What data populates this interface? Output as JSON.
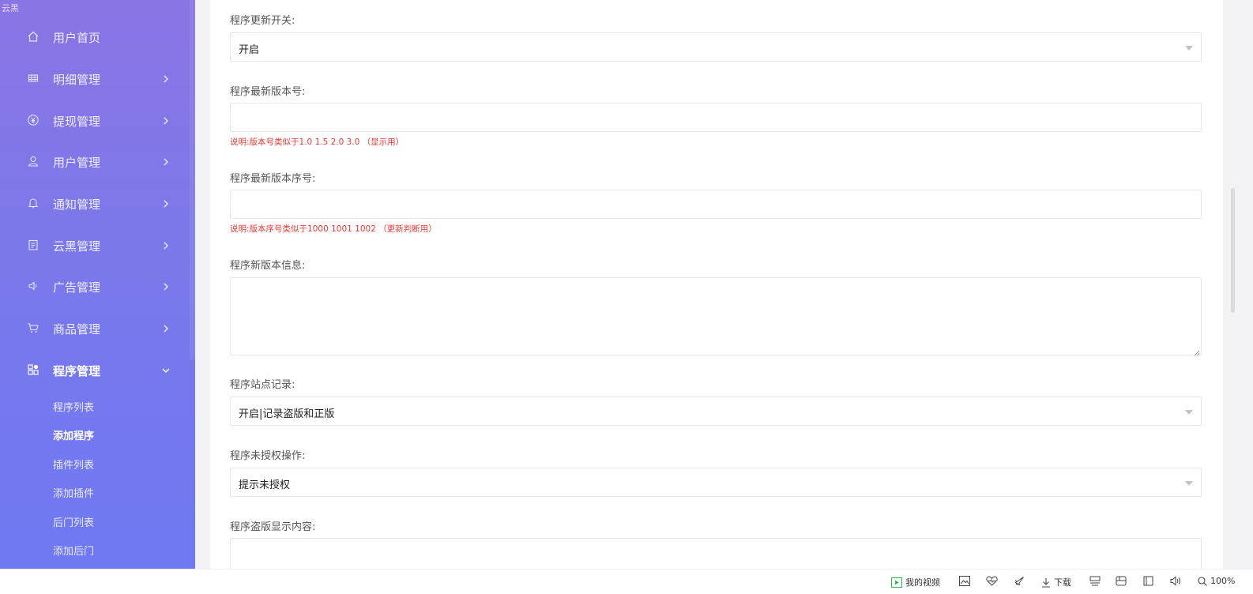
{
  "sidebar": {
    "corner_text": "云黑",
    "items": [
      {
        "label": "用户首页",
        "icon": "home-icon"
      },
      {
        "label": "明细管理",
        "icon": "list-icon"
      },
      {
        "label": "提现管理",
        "icon": "yen-icon"
      },
      {
        "label": "用户管理",
        "icon": "user-icon"
      },
      {
        "label": "通知管理",
        "icon": "bell-icon"
      },
      {
        "label": "云黑管理",
        "icon": "clipboard-icon"
      },
      {
        "label": "广告管理",
        "icon": "speaker-icon"
      },
      {
        "label": "商品管理",
        "icon": "cart-icon"
      },
      {
        "label": "程序管理",
        "icon": "apps-icon",
        "expanded": true
      }
    ],
    "subitems": [
      {
        "label": "程序列表"
      },
      {
        "label": "添加程序",
        "current": true
      },
      {
        "label": "插件列表"
      },
      {
        "label": "添加插件"
      },
      {
        "label": "后门列表"
      },
      {
        "label": "添加后门"
      }
    ]
  },
  "form": {
    "update_switch": {
      "label": "程序更新开关:",
      "value": "开启"
    },
    "latest_version": {
      "label": "程序最新版本号:",
      "value": "",
      "hint": "说明:版本号类似于1.0 1.5 2.0 3.0 （显示用）"
    },
    "latest_serial": {
      "label": "程序最新版本序号:",
      "value": "",
      "hint": "说明:版本序号类似于1000 1001 1002 （更新判断用）"
    },
    "new_version_info": {
      "label": "程序新版本信息:",
      "value": ""
    },
    "site_record": {
      "label": "程序站点记录:",
      "value": "开启|记录盗版和正版"
    },
    "unauthorized_action": {
      "label": "程序未授权操作:",
      "value": "提示未授权"
    },
    "piracy_content": {
      "label": "程序盗版显示内容:",
      "value": ""
    }
  },
  "statusbar": {
    "video_label": "我的视频",
    "download_label": "下载",
    "zoom": "100%"
  },
  "colors": {
    "sidebar_top": "#8b74e3",
    "sidebar_bottom": "#6f79f2",
    "hint_red": "#e53935",
    "video_green": "#2db84d"
  }
}
